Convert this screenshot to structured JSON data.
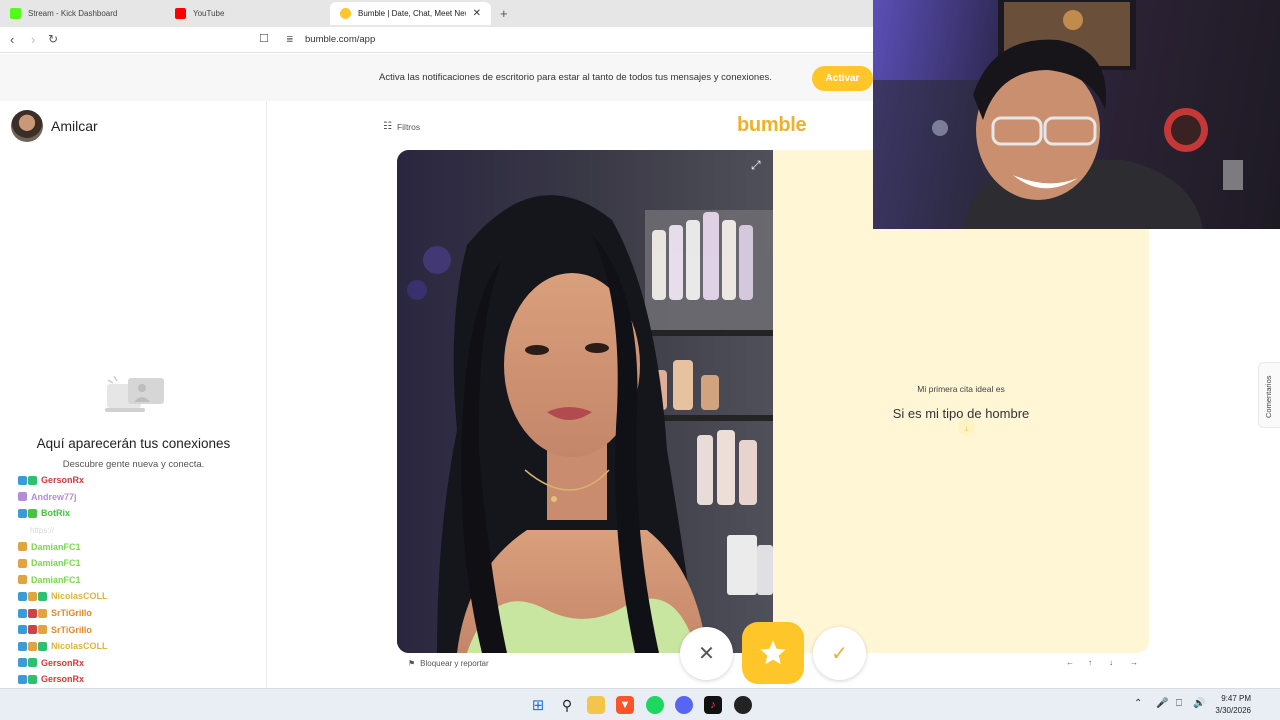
{
  "browser": {
    "tabs": [
      {
        "title": "Stream - Kick Dashboard",
        "favicon_color": "#53fc18"
      },
      {
        "title": "YouTube",
        "favicon_color": "#ff0000"
      },
      {
        "title": "Bumble | Date, Chat, Meet New F",
        "favicon_color": "#ffc629",
        "active": true
      }
    ],
    "new_tab_symbol": "+",
    "url": "bumble.com/app"
  },
  "banner": {
    "text": "Activa las notificaciones de escritorio para estar al tanto de todos tus mensajes y conexiones.",
    "button_label": "Activar"
  },
  "sidebar": {
    "username": "Amilcar",
    "empty_title": "Aquí aparecerán tus conexiones",
    "empty_subtitle": "Descubre gente nueva y conecta."
  },
  "chat": [
    {
      "name": "GersonRx",
      "color": "#d03a3a",
      "msg": ""
    },
    {
      "name": "Andrew77j",
      "color": "#b48cd8",
      "msg": ""
    },
    {
      "name": "BotRix",
      "color": "#45c53d",
      "msg": ""
    },
    {
      "name": "",
      "color": "#999999",
      "msg": "https://"
    },
    {
      "name": "DamianFC1",
      "color": "#7dd64f",
      "msg": ""
    },
    {
      "name": "DamianFC1",
      "color": "#7dd64f",
      "msg": ""
    },
    {
      "name": "DamianFC1",
      "color": "#7dd64f",
      "msg": ""
    },
    {
      "name": "NicolasCOLL",
      "color": "#e0b23c",
      "msg": ""
    },
    {
      "name": "SrTiGrillo",
      "color": "#e08a2a",
      "msg": ""
    },
    {
      "name": "SrTiGrillo",
      "color": "#e08a2a",
      "msg": ""
    },
    {
      "name": "NicolasCOLL",
      "color": "#e0b23c",
      "msg": ""
    },
    {
      "name": "GersonRx",
      "color": "#d03a3a",
      "msg": ""
    },
    {
      "name": "GersonRx",
      "color": "#d03a3a",
      "msg": ""
    }
  ],
  "main": {
    "filters_label": "Filtros",
    "logo": "bumble",
    "prompt_label": "Mi primera cita ideal es",
    "prompt_answer": "Si es mi tipo de hombre",
    "report_label": "Bloquear y reportar",
    "comments_label": "Comentarios",
    "kbd_hints": [
      "←",
      "↑",
      "↓",
      "→"
    ],
    "accent_color": "#ffc629"
  },
  "taskbar": {
    "time": "9:47 PM",
    "date": "3/30/2026"
  }
}
